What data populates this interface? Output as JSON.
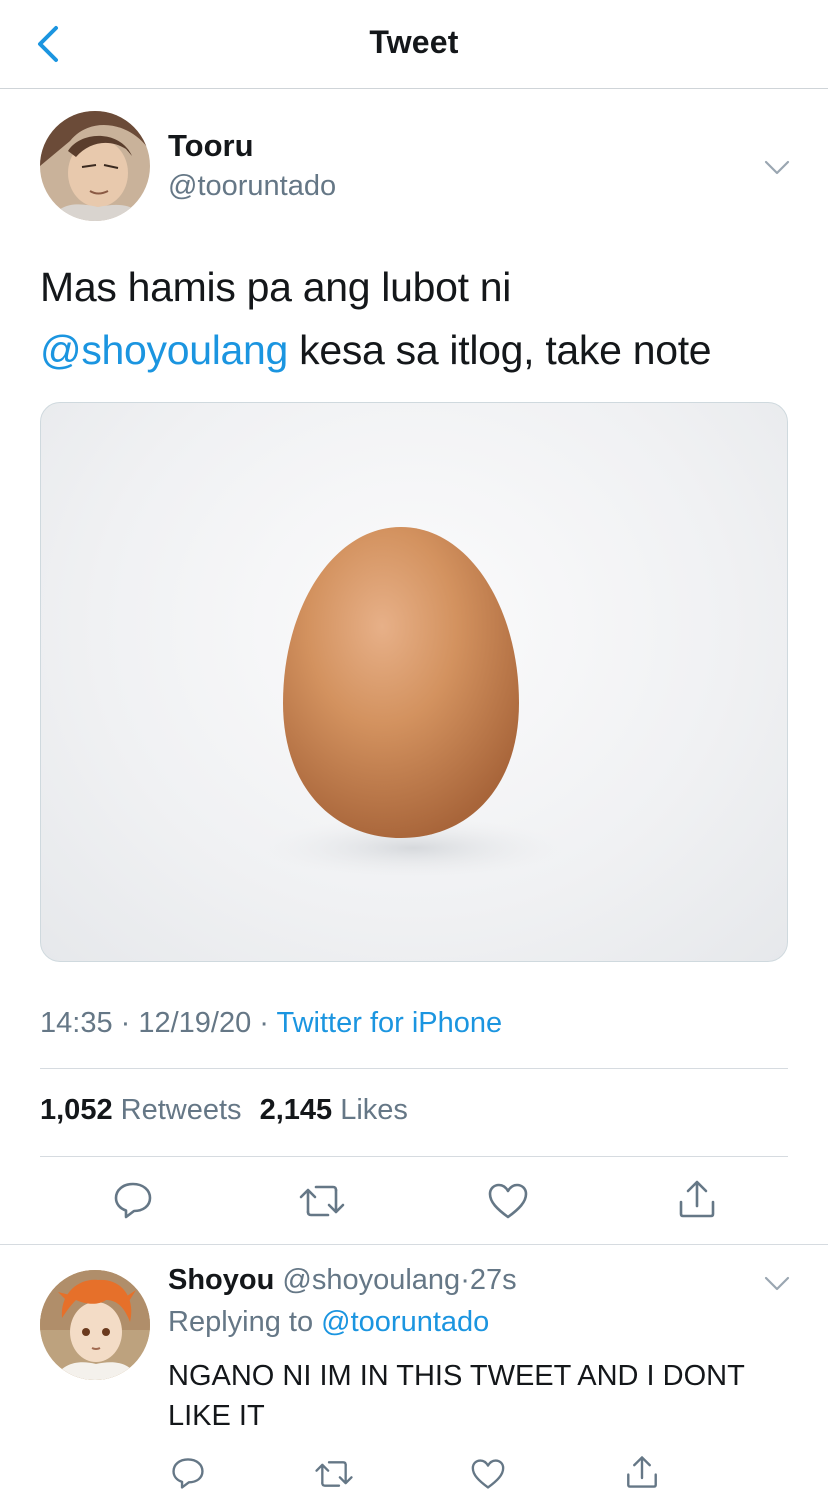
{
  "nav": {
    "title": "Tweet",
    "back_icon": "chevron-left-icon",
    "accent": "#1b95e0"
  },
  "tweet": {
    "author_name": "Tooru",
    "author_handle": "@tooruntado",
    "text_part1": "Mas hamis pa ang lubot ni",
    "mention": "@shoyoulang",
    "text_part2": " kesa sa itlog, take note",
    "time": "14:35",
    "separator": " · ",
    "date": "12/19/20",
    "source": "Twitter for iPhone",
    "retweets_count": "1,052",
    "retweets_label": "Retweets",
    "likes_count": "2,145",
    "likes_label": "Likes"
  },
  "reply": {
    "author_name": "Shoyou",
    "author_handle": "@shoyoulang",
    "separator": "·",
    "time": "27s",
    "replying_prefix": "Replying to ",
    "replying_to": "@tooruntado",
    "text": "NGANO NI IM IN THIS TWEET AND I DONT LIKE IT"
  },
  "icons": [
    "chevron-left-icon",
    "chevron-down-icon",
    "reply-icon",
    "retweet-icon",
    "like-icon",
    "share-icon"
  ],
  "colors": {
    "link": "#1b95e0",
    "secondary_text": "#657786",
    "primary_text": "#14171a",
    "divider": "#d6dbe0"
  }
}
